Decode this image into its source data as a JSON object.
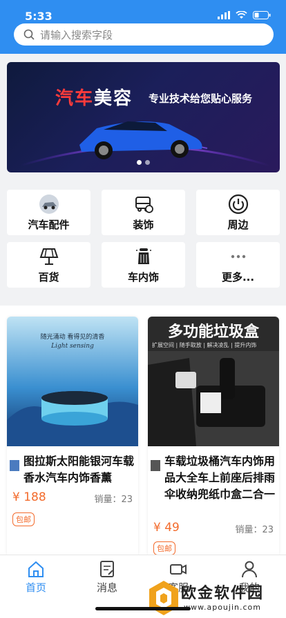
{
  "status_bar": {
    "time": "5:33"
  },
  "search": {
    "placeholder": "请输入搜索字段"
  },
  "banner": {
    "title_red": "汽车",
    "title_white": "美容",
    "subtitle": "专业技术给您贴心服务",
    "active_dot": 0,
    "dot_count": 2
  },
  "categories": [
    {
      "label": "汽车配件",
      "icon": "car-photo-icon"
    },
    {
      "label": "装饰",
      "icon": "car-decor-icon"
    },
    {
      "label": "周边",
      "icon": "power-icon"
    },
    {
      "label": "百货",
      "icon": "lamp-icon"
    },
    {
      "label": "车内饰",
      "icon": "seat-icon"
    },
    {
      "label": "更多...",
      "icon": "more-dots-icon"
    }
  ],
  "products": [
    {
      "name": "图拉斯太阳能银河车载香水汽车内饰香薰",
      "image_caption": "随光涌动 看得见的清香",
      "image_caption_en": "Light sensing",
      "price": "¥ 188",
      "sales": "销量：23",
      "tag": "包邮"
    },
    {
      "name": "车载垃圾桶汽车内饰用品大全车上前座后排雨伞收纳兜纸巾盒二合一",
      "image_title": "多功能垃圾盒",
      "image_features": "扩展空间 | 随手取放 | 解决凌乱 | 提升内饰",
      "price": "¥ 49",
      "sales": "销量：23",
      "tag": "包邮"
    }
  ],
  "tabs": [
    {
      "label": "首页",
      "icon": "home-icon",
      "active": true
    },
    {
      "label": "消息",
      "icon": "message-icon",
      "active": false
    },
    {
      "label": "客服",
      "icon": "video-icon",
      "active": false
    },
    {
      "label": "我的",
      "icon": "user-icon",
      "active": false
    }
  ],
  "watermark": {
    "text": "欧金软件园",
    "url": "www.apoujin.com"
  },
  "colors": {
    "primary": "#2f8ef1",
    "price": "#f36b2c"
  }
}
